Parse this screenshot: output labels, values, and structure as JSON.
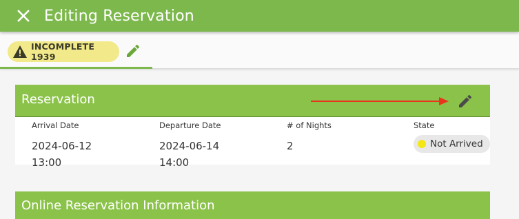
{
  "appbar": {
    "title": "Editing Reservation",
    "close_icon": "close-icon"
  },
  "tabbar": {
    "badge_icon": "warning-icon",
    "badge_text": "INCOMPLETE 1939",
    "edit_icon": "pencil-icon",
    "badge_color": "#f1e98a",
    "accent_color": "#7cb84c"
  },
  "reservation": {
    "title": "Reservation",
    "edit_icon": "pencil-icon",
    "arrival_label": "Arrival Date",
    "arrival_date": "2024-06-12",
    "arrival_time": "13:00",
    "departure_label": "Departure Date",
    "departure_date": "2024-06-14",
    "departure_time": "14:00",
    "nights_label": "# of Nights",
    "nights_value": "2",
    "state_label": "State",
    "state_value": "Not Arrived",
    "state_color": "#f5e615"
  },
  "annotation": {
    "arrow_color": "#e8361e"
  },
  "online": {
    "title": "Online Reservation Information"
  }
}
